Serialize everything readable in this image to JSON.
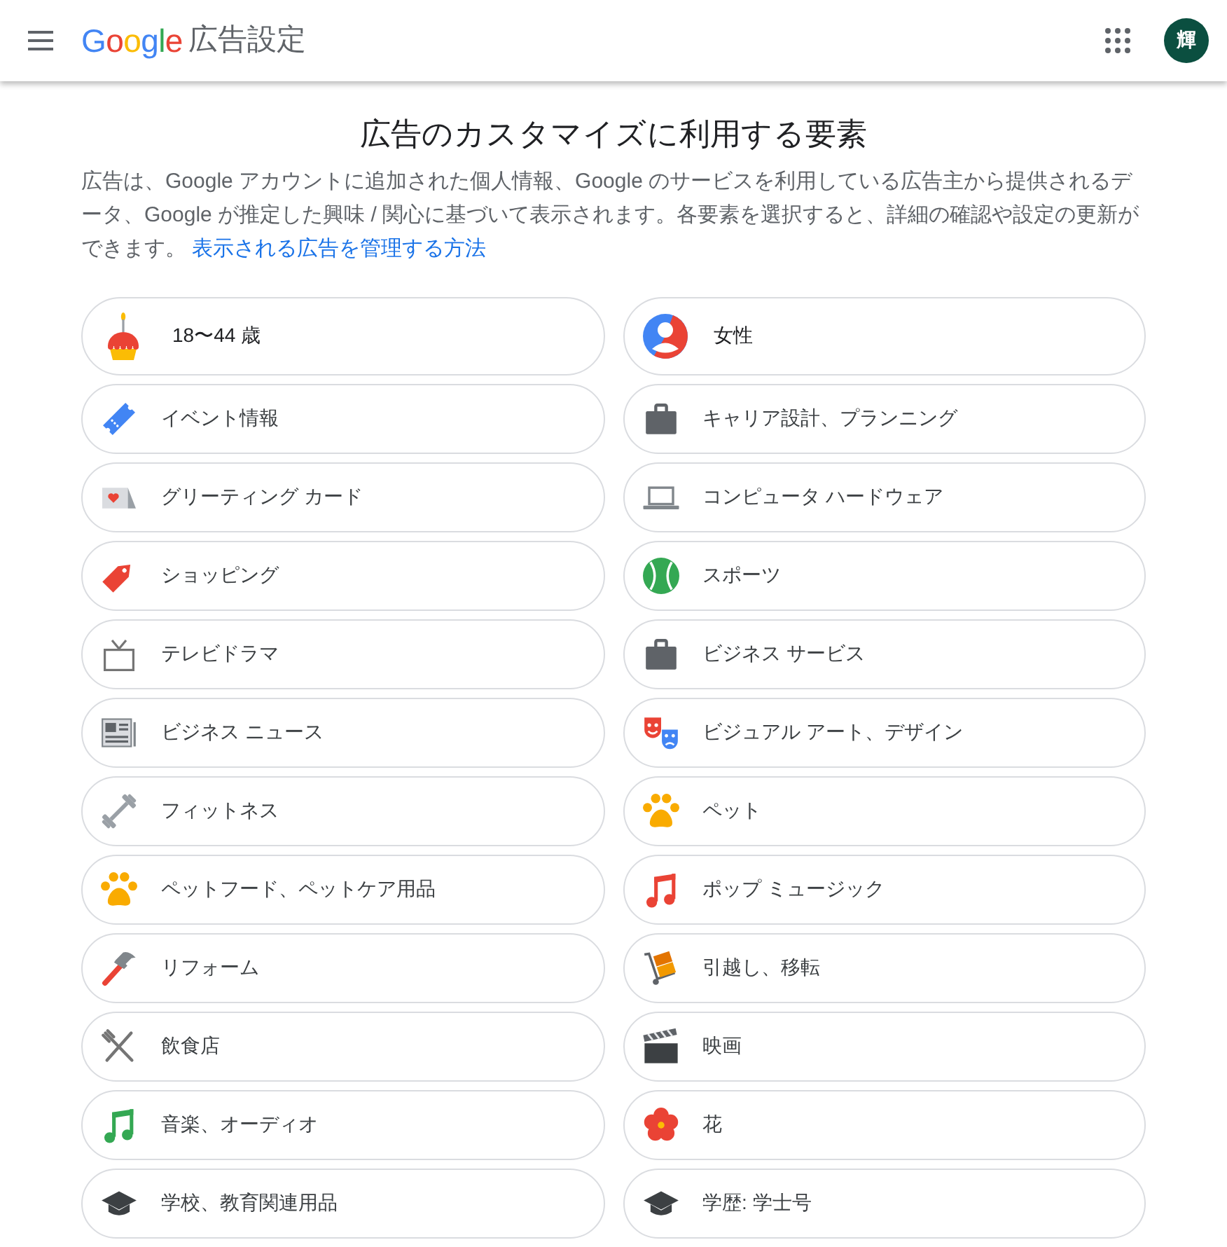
{
  "header": {
    "logo": "Google",
    "title": "広告設定",
    "avatar": "輝"
  },
  "heading": "広告のカスタマイズに利用する要素",
  "intro": {
    "text": "広告は、Google アカウントに追加された個人情報、Google のサービスを利用している広告主から提供されるデータ、Google が推定した興味 / 関心に基づいて表示されます。各要素を選択すると、詳細の確認や設定の更新ができます。",
    "link": "表示される広告を管理する方法"
  },
  "items": [
    {
      "kind": "demographic",
      "label": "18〜44 歳"
    },
    {
      "kind": "demographic",
      "label": "女性"
    },
    {
      "kind": "interest",
      "label": "イベント情報"
    },
    {
      "kind": "interest",
      "label": "キャリア設計、プランニング"
    },
    {
      "kind": "interest",
      "label": "グリーティング カード"
    },
    {
      "kind": "interest",
      "label": "コンピュータ ハードウェア"
    },
    {
      "kind": "interest",
      "label": "ショッピング"
    },
    {
      "kind": "interest",
      "label": "スポーツ"
    },
    {
      "kind": "interest",
      "label": "テレビドラマ"
    },
    {
      "kind": "interest",
      "label": "ビジネス サービス"
    },
    {
      "kind": "interest",
      "label": "ビジネス ニュース"
    },
    {
      "kind": "interest",
      "label": "ビジュアル アート、デザイン"
    },
    {
      "kind": "interest",
      "label": "フィットネス"
    },
    {
      "kind": "interest",
      "label": "ペット"
    },
    {
      "kind": "interest",
      "label": "ペットフード、ペットケア用品"
    },
    {
      "kind": "interest",
      "label": "ポップ ミュージック"
    },
    {
      "kind": "interest",
      "label": "リフォーム"
    },
    {
      "kind": "interest",
      "label": "引越し、移転"
    },
    {
      "kind": "interest",
      "label": "飲食店"
    },
    {
      "kind": "interest",
      "label": "映画"
    },
    {
      "kind": "interest",
      "label": "音楽、オーディオ"
    },
    {
      "kind": "interest",
      "label": "花"
    },
    {
      "kind": "interest",
      "label": "学校、教育関連用品"
    },
    {
      "kind": "interest",
      "label": "学歴: 学士号"
    }
  ]
}
